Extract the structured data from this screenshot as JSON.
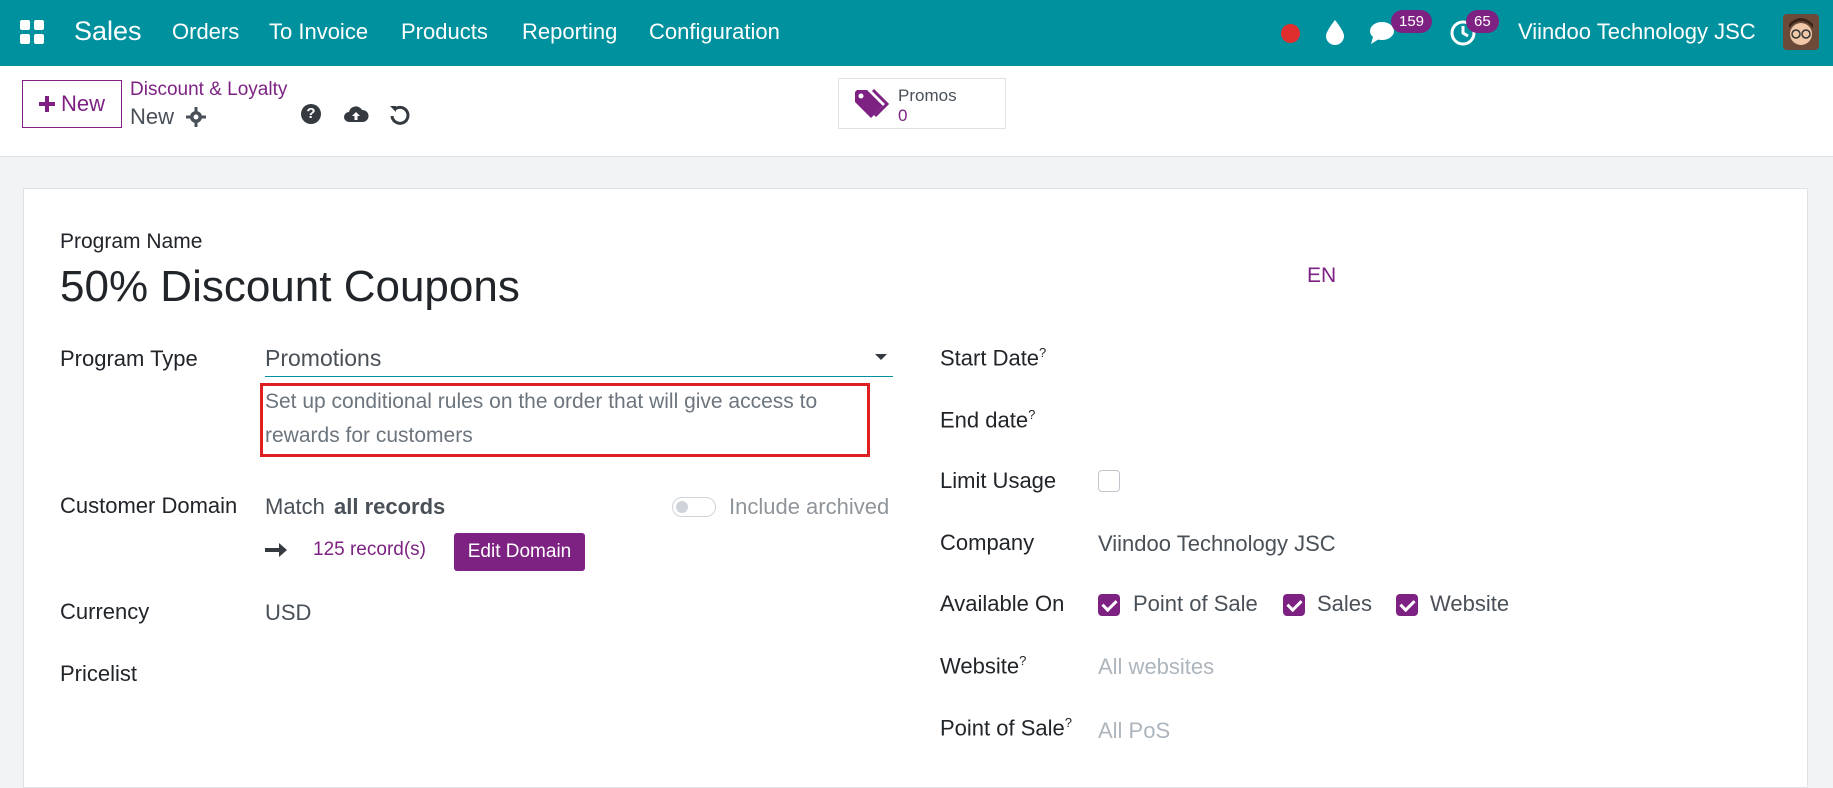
{
  "navbar": {
    "app_name": "Sales",
    "menu": [
      "Orders",
      "To Invoice",
      "Products",
      "Reporting",
      "Configuration"
    ],
    "messages_count": "159",
    "activities_count": "65",
    "company": "Viindoo Technology JSC"
  },
  "control_panel": {
    "new_label": "New",
    "breadcrumb_parent": "Discount & Loyalty",
    "breadcrumb_current": "New",
    "stat_label": "Promos",
    "stat_value": "0"
  },
  "form": {
    "program_name_label": "Program Name",
    "program_name": "50% Discount Coupons",
    "lang": "EN",
    "program_type_label": "Program Type",
    "program_type": "Promotions",
    "program_type_help": "Set up conditional rules on the order that will give access to rewards for customers",
    "customer_domain_label": "Customer Domain",
    "match_prefix": "Match",
    "match_value": "all records",
    "include_archived": "Include archived",
    "record_count": "125 record(s)",
    "edit_domain": "Edit Domain",
    "currency_label": "Currency",
    "currency": "USD",
    "pricelist_label": "Pricelist",
    "start_date_label": "Start Date",
    "end_date_label": "End date",
    "limit_usage_label": "Limit Usage",
    "company_label": "Company",
    "company": "Viindoo Technology JSC",
    "available_on_label": "Available On",
    "available_on": [
      {
        "label": "Point of Sale",
        "checked": true
      },
      {
        "label": "Sales",
        "checked": true
      },
      {
        "label": "Website",
        "checked": true
      }
    ],
    "website_label": "Website",
    "website_placeholder": "All websites",
    "pos_label": "Point of Sale",
    "pos_placeholder": "All PoS",
    "help_mark": "?"
  },
  "colors": {
    "navbar": "#00919f",
    "accent": "#7d2283",
    "highlight_box": "#e02020"
  }
}
